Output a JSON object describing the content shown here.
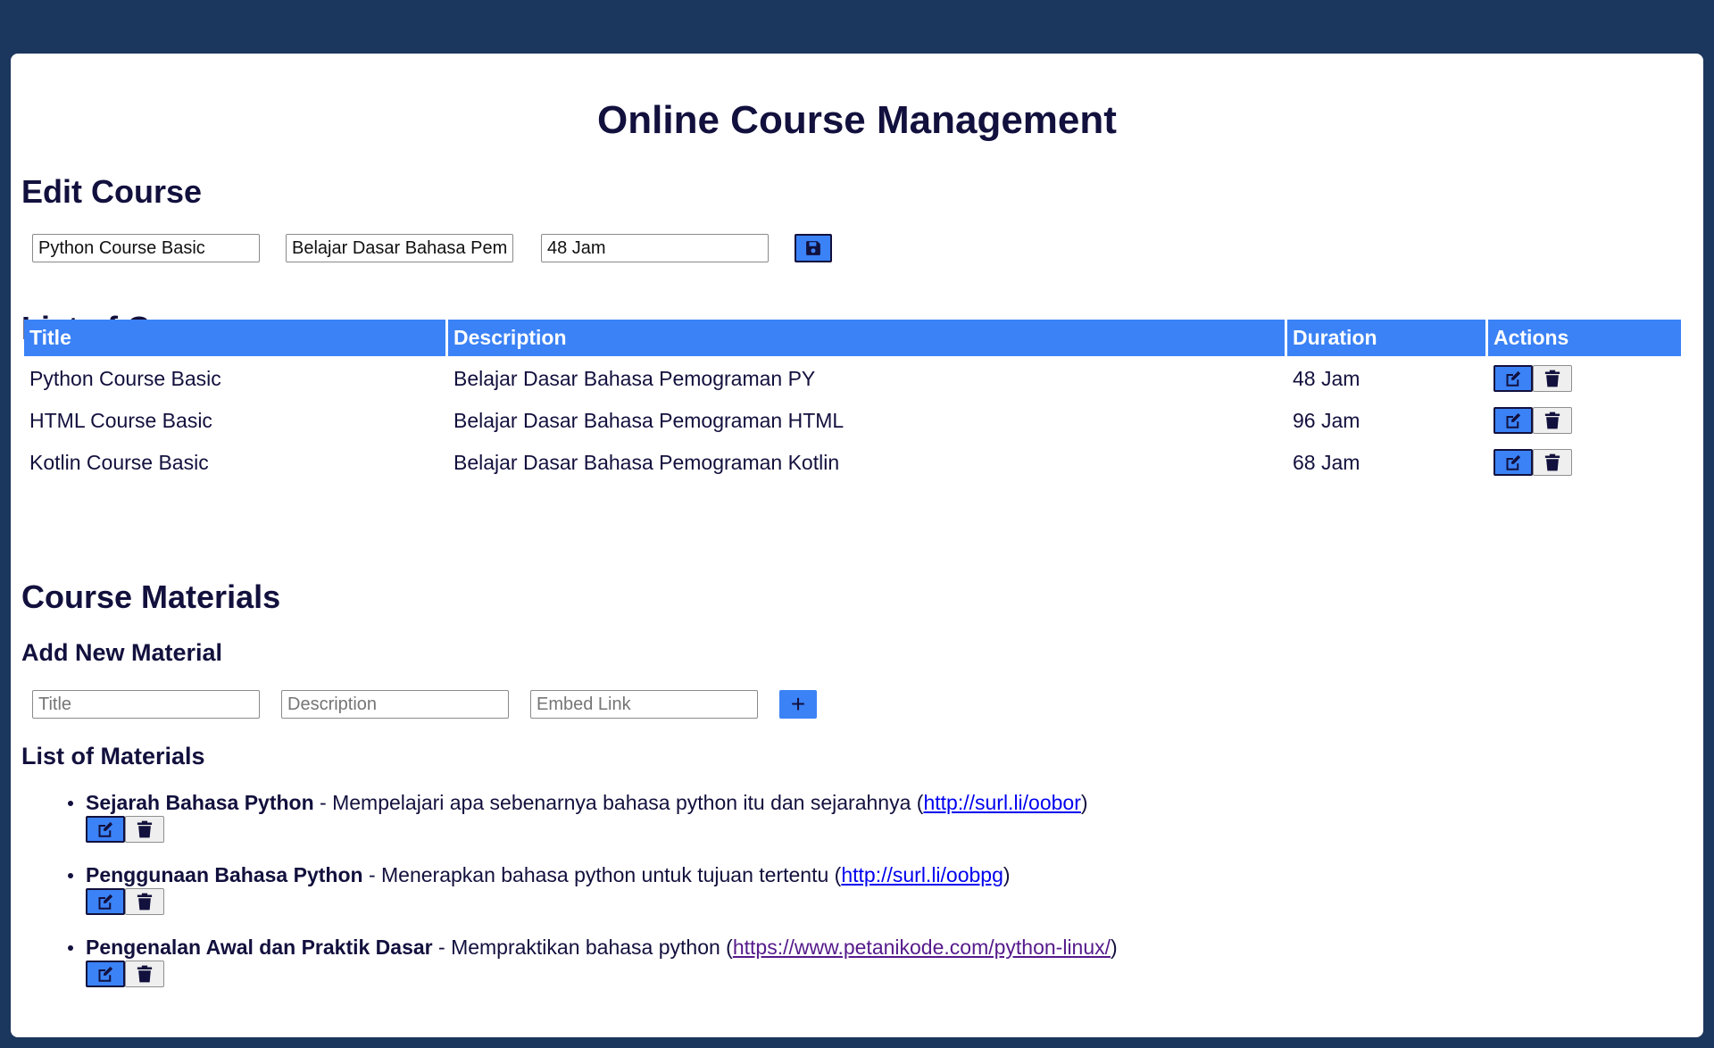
{
  "page": {
    "title": "Online Course Management"
  },
  "edit_course": {
    "heading": "Edit Course",
    "title_value": "Python Course Basic",
    "description_value": "Belajar Dasar Bahasa Pemograman PY",
    "duration_value": "48 Jam",
    "save_icon": "save-icon"
  },
  "courses": {
    "heading": "List of Courses",
    "columns": [
      "Title",
      "Description",
      "Duration",
      "Actions"
    ],
    "rows": [
      {
        "title": "Python Course Basic",
        "description": "Belajar Dasar Bahasa Pemograman PY",
        "duration": "48 Jam"
      },
      {
        "title": "HTML Course Basic",
        "description": "Belajar Dasar Bahasa Pemograman HTML",
        "duration": "96 Jam"
      },
      {
        "title": "Kotlin Course Basic",
        "description": "Belajar Dasar Bahasa Pemograman Kotlin",
        "duration": "68 Jam"
      }
    ]
  },
  "materials": {
    "heading": "Course Materials",
    "add_heading": "Add New Material",
    "title_placeholder": "Title",
    "description_placeholder": "Description",
    "embed_placeholder": "Embed Link",
    "add_label": "+",
    "list_heading": "List of Materials",
    "items": [
      {
        "title": "Sejarah Bahasa Python",
        "description": "Mempelajari apa sebenarnya bahasa python itu dan sejarahnya",
        "link": "http://surl.li/oobor"
      },
      {
        "title": "Penggunaan Bahasa Python",
        "description": "Menerapkan bahasa python untuk tujuan tertentu",
        "link": "http://surl.li/oobpg"
      },
      {
        "title": "Pengenalan Awal dan Praktik Dasar",
        "description": "Mempraktikan bahasa python",
        "link": "https://www.petanikode.com/python-linux/"
      }
    ]
  },
  "colors": {
    "background": "#1c375e",
    "accent": "#3b82f6",
    "text": "#12103d"
  },
  "icons": {
    "edit": "edit-icon",
    "delete": "trash-icon",
    "save": "save-icon"
  }
}
